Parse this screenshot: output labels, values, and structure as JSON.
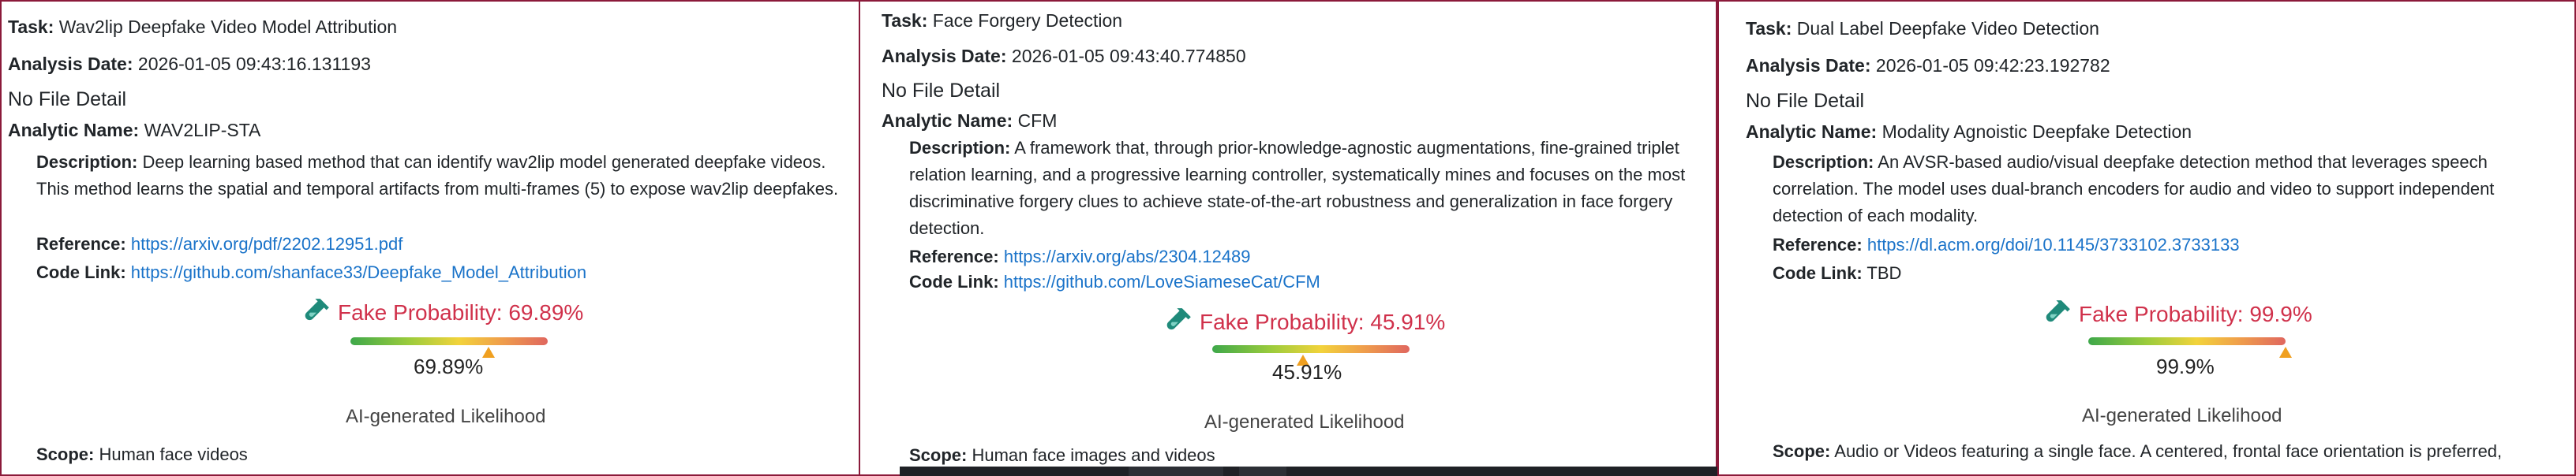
{
  "labels": {
    "task": "Task:",
    "analysis_date": "Analysis Date:",
    "analytic_name": "Analytic Name:",
    "description": "Description:",
    "reference": "Reference:",
    "code_link": "Code Link:",
    "scope": "Scope:",
    "fake_probability_prefix": "Fake Probability:",
    "ai_likelihood": "AI-generated Likelihood"
  },
  "panels": [
    {
      "task": "Wav2lip Deepfake Video Model Attribution",
      "analysis_date": "2026-01-05 09:43:16.131193",
      "file_detail": "No File Detail",
      "analytic_name": "WAV2LIP-STA",
      "description": "Deep learning based method that can identify wav2lip model generated deepfake videos. This method learns the spatial and temporal artifacts from multi-frames (5) to expose wav2lip deepfakes.",
      "reference": "https://arxiv.org/pdf/2202.12951.pdf",
      "code_link": "https://github.com/shanface33/Deepfake_Model_Attribution",
      "fake_probability": "Fake Probability: 69.89%",
      "percent_text": "69.89%",
      "probability": 0.6989,
      "scope": "Human face videos"
    },
    {
      "task": "Face Forgery Detection",
      "analysis_date": "2026-01-05 09:43:40.774850",
      "file_detail": "No File Detail",
      "analytic_name": "CFM",
      "description": "A framework that, through prior-knowledge-agnostic augmentations, fine-grained triplet relation learning, and a progressive learning controller, systematically mines and focuses on the most discriminative forgery clues to achieve state-of-the-art robustness and generalization in face forgery detection.",
      "reference": "https://arxiv.org/abs/2304.12489",
      "code_link": "https://github.com/LoveSiameseCat/CFM",
      "fake_probability": "Fake Probability: 45.91%",
      "percent_text": "45.91%",
      "probability": 0.4591,
      "scope": "Human face images and videos"
    },
    {
      "task": "Dual Label Deepfake Video Detection",
      "analysis_date": "2026-01-05 09:42:23.192782",
      "file_detail": "No File Detail",
      "analytic_name": "Modality Agnoistic Deepfake Detection",
      "description": "An AVSR-based audio/visual deepfake detection method that leverages speech correlation. The model uses dual-branch encoders for audio and video to support independent detection of each modality.",
      "reference": "https://dl.acm.org/doi/10.1145/3733102.3733133",
      "code_link": "TBD",
      "fake_probability": "Fake Probability: 99.9%",
      "percent_text": "99.9%",
      "probability": 0.999,
      "scope": "Audio or Videos featuring a single face. A centered, frontal face orientation is preferred,"
    }
  ],
  "colors": {
    "border": "#8b1a3a",
    "probability_text": "#d0314b",
    "link": "#1a73c9",
    "marker": "#f0a020",
    "icon": "#1f8a7a"
  },
  "icons": {
    "probability": "test-tube-icon"
  }
}
